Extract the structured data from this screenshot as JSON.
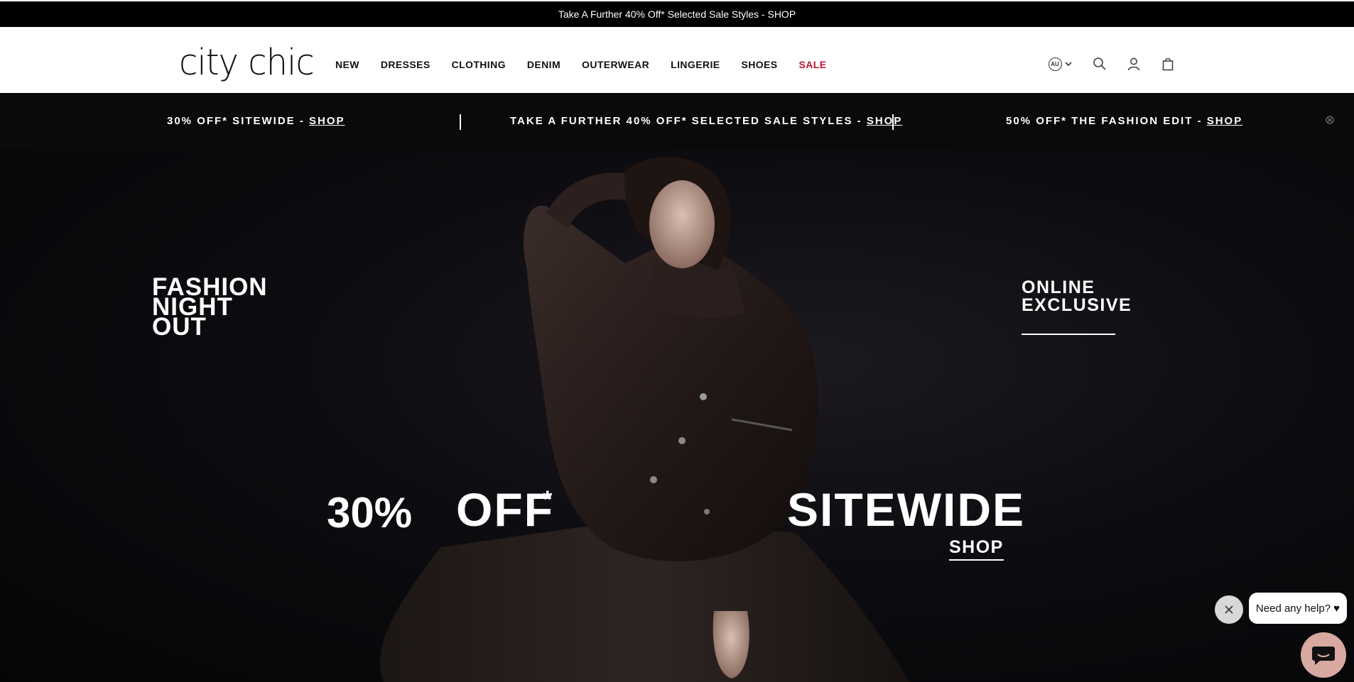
{
  "announcement": {
    "text": "Take A Further 40% Off* Selected Sale Styles - SHOP"
  },
  "header": {
    "logo": "city chic",
    "nav": [
      {
        "label": "NEW"
      },
      {
        "label": "DRESSES"
      },
      {
        "label": "CLOTHING"
      },
      {
        "label": "DENIM"
      },
      {
        "label": "OUTERWEAR"
      },
      {
        "label": "LINGERIE"
      },
      {
        "label": "SHOES"
      },
      {
        "label": "SALE",
        "color": "#c4122f"
      }
    ],
    "locale": "AU",
    "icons": [
      "globe-locale-icon",
      "search-icon",
      "account-icon",
      "bag-icon"
    ]
  },
  "promos": [
    {
      "text": "30% OFF* SITEWIDE - ",
      "link": "SHOP"
    },
    {
      "text": "TAKE A FURTHER 40% OFF* SELECTED SALE STYLES - ",
      "link": "SHOP"
    },
    {
      "text": "50% OFF* THE FASHION EDIT - ",
      "link": "SHOP"
    }
  ],
  "hero": {
    "left_title": [
      "FASHION",
      "NIGHT",
      "OUT"
    ],
    "right_title": [
      "ONLINE",
      "EXCLUSIVE"
    ],
    "percent": "30%",
    "off": "OFF",
    "asterisk": "*",
    "sitewide": "SITEWIDE",
    "shop": "SHOP"
  },
  "chat": {
    "bubble": "Need any help? ♥"
  },
  "colors": {
    "sale": "#c4122f",
    "promo_bg": "#0a0a0a",
    "chat_launcher": "#d7a9a0"
  }
}
